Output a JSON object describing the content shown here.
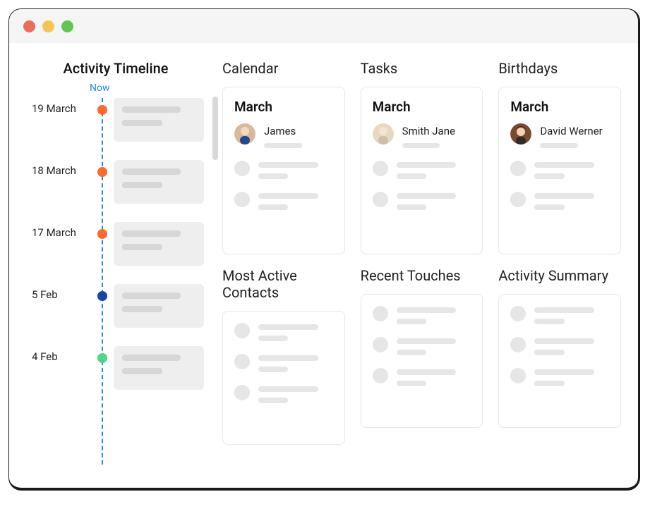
{
  "timeline": {
    "title": "Activity Timeline",
    "now_label": "Now",
    "items": [
      {
        "date": "19 March",
        "dot": "orange"
      },
      {
        "date": "18 March",
        "dot": "orange"
      },
      {
        "date": "17 March",
        "dot": "orange"
      },
      {
        "date": "5 Feb",
        "dot": "blue"
      },
      {
        "date": "4 Feb",
        "dot": "green"
      }
    ]
  },
  "grid": {
    "top": [
      {
        "title": "Calendar",
        "month": "March",
        "person": "James"
      },
      {
        "title": "Tasks",
        "month": "March",
        "person": "Smith Jane"
      },
      {
        "title": "Birthdays",
        "month": "March",
        "person": "David Werner"
      }
    ],
    "bottom": [
      {
        "title": "Most Active Contacts"
      },
      {
        "title": "Recent Touches"
      },
      {
        "title": "Activity Summary"
      }
    ]
  }
}
